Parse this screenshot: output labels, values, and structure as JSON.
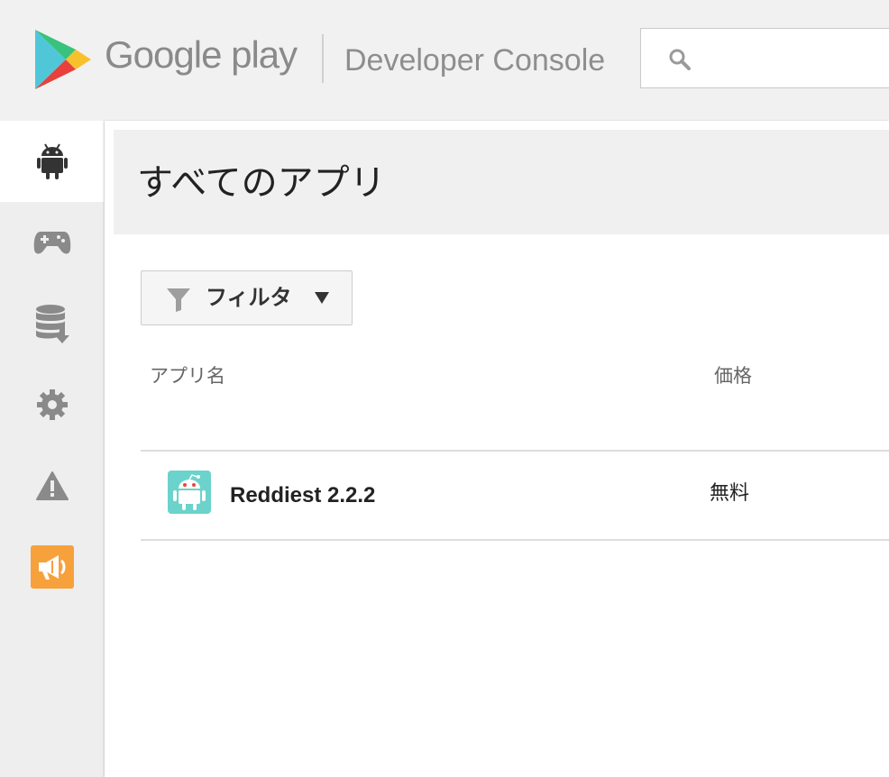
{
  "header": {
    "brand_google": "Google",
    "brand_play": "play",
    "product": "Developer Console",
    "search": {
      "value": "",
      "icon": "search-icon"
    }
  },
  "sidebar": {
    "items": [
      {
        "icon": "android-icon",
        "active": true
      },
      {
        "icon": "gamepad-icon",
        "active": false
      },
      {
        "icon": "database-download-icon",
        "active": false
      },
      {
        "icon": "gear-icon",
        "active": false
      },
      {
        "icon": "warning-icon",
        "active": false
      },
      {
        "icon": "megaphone-icon",
        "active": false,
        "color": "#f7a13c"
      }
    ]
  },
  "main": {
    "title": "すべてのアプリ",
    "filter": {
      "label": "フィルタ",
      "icon": "funnel-icon",
      "caret": "▼"
    },
    "table": {
      "columns": [
        "アプリ名",
        "価格"
      ],
      "rows": [
        {
          "name": "Reddiest 2.2.2",
          "price": "無料",
          "icon": "reddit-android-icon",
          "icon_color": "#6cd2cc"
        }
      ]
    }
  }
}
